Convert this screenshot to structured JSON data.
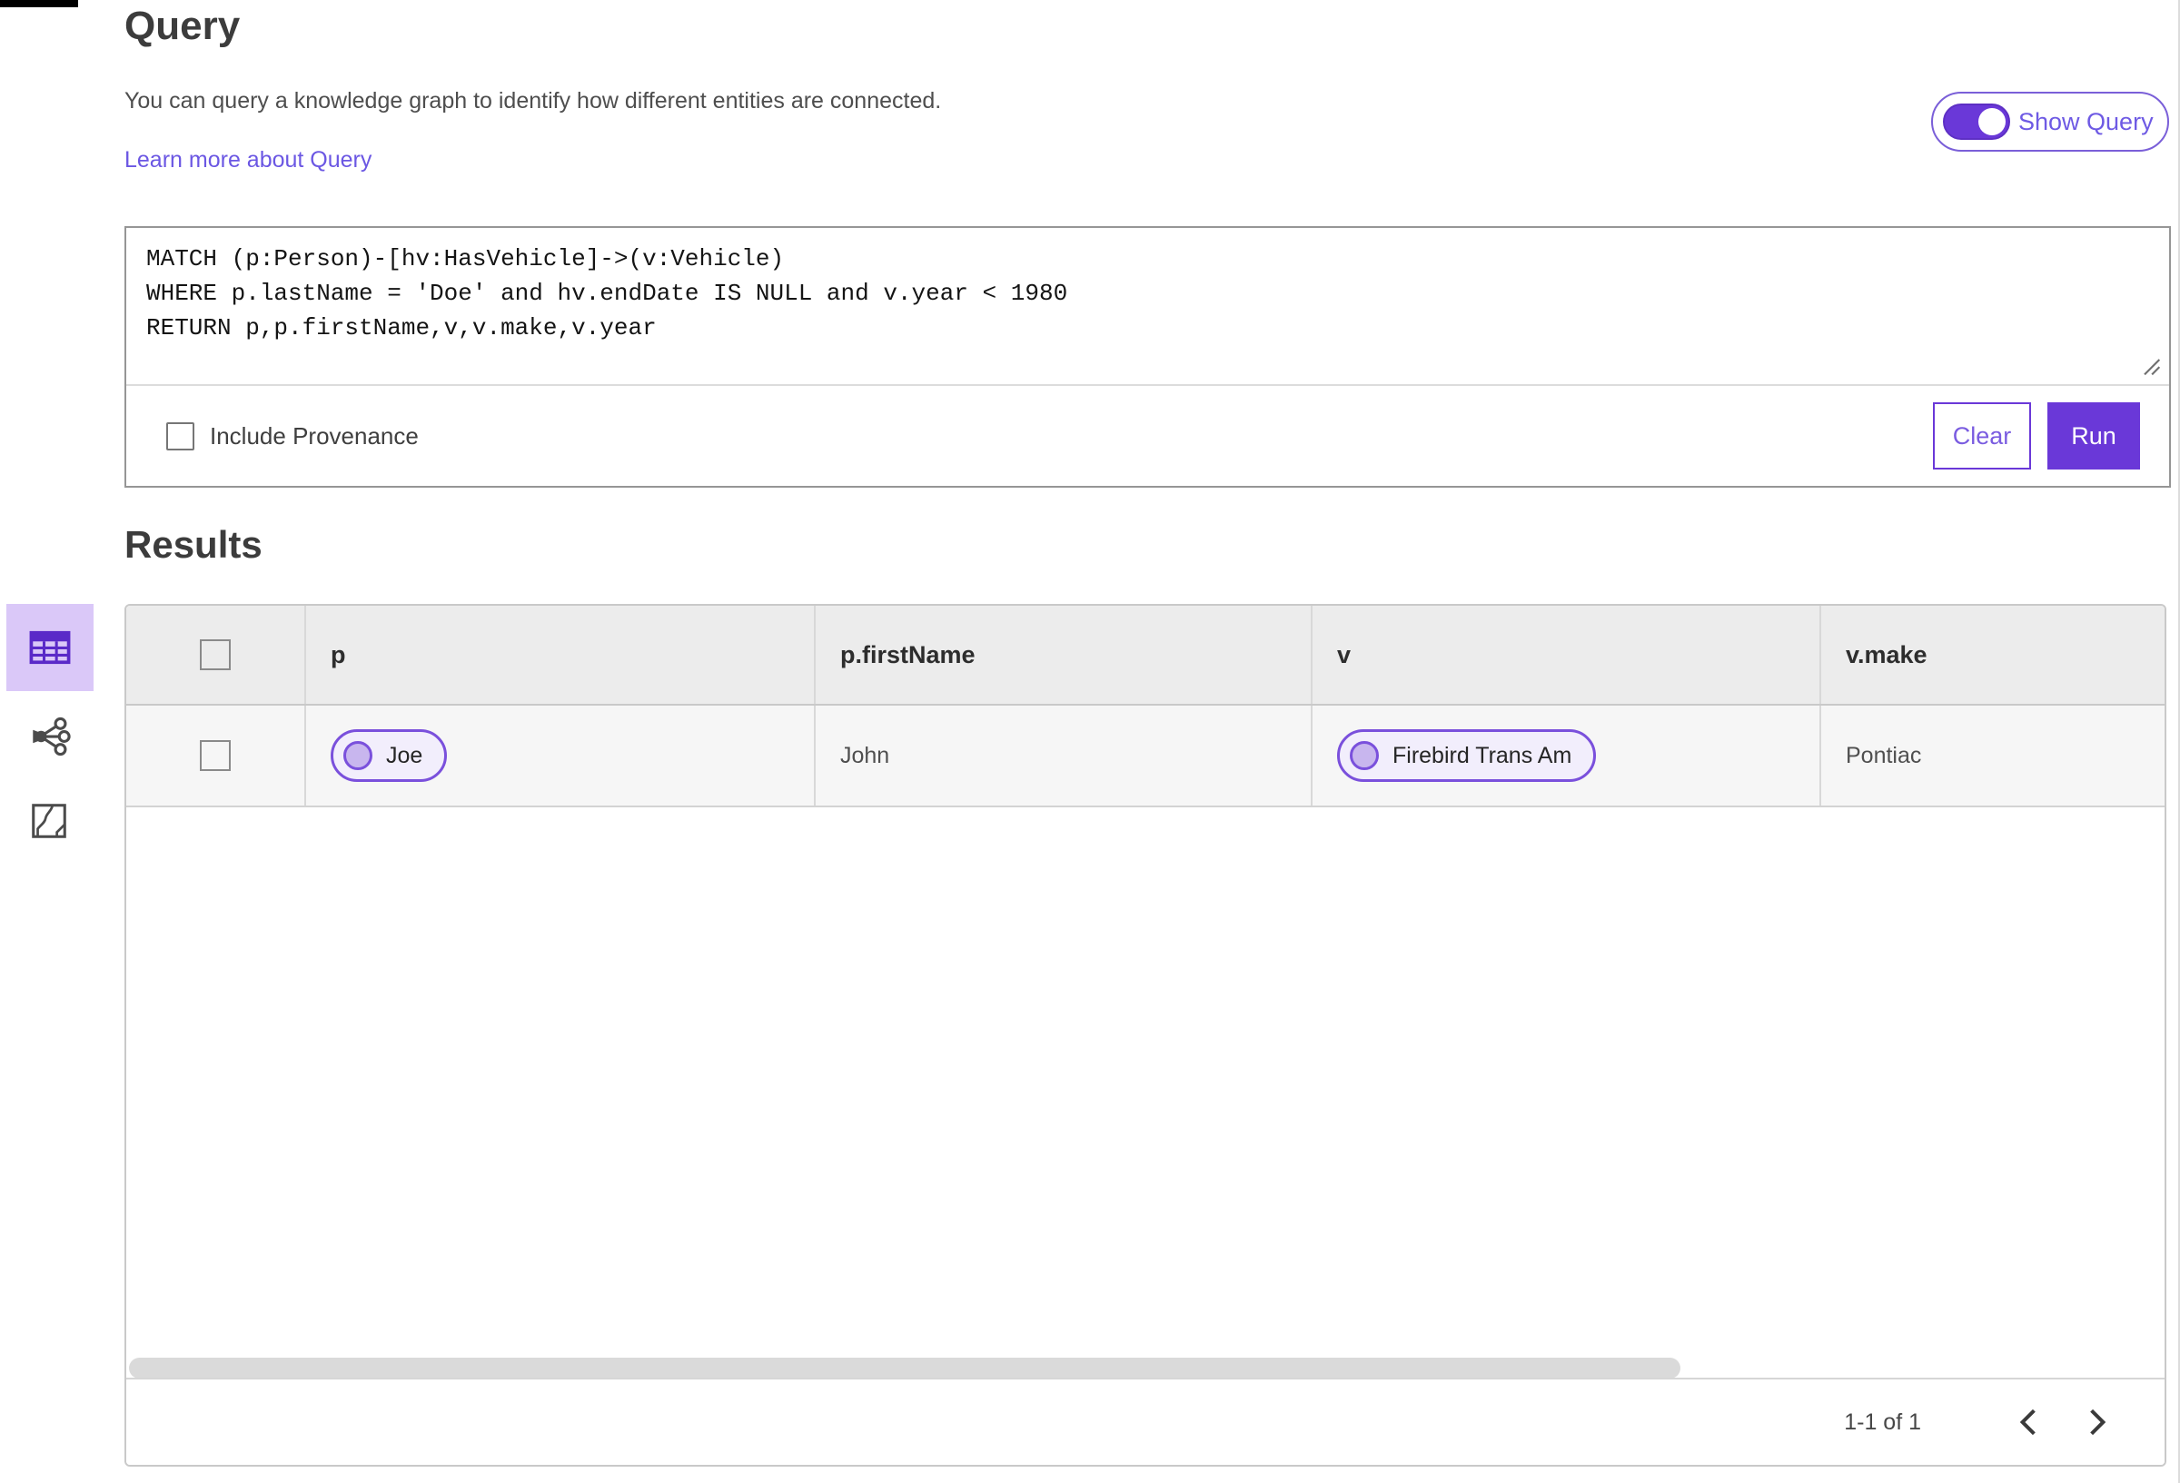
{
  "query_section": {
    "title": "Query",
    "description": "You can query a knowledge graph to identify how different entities are connected.",
    "learn_more_link": "Learn more about Query",
    "show_query_toggle": {
      "label": "Show Query",
      "state_on": true
    },
    "query_text": "MATCH (p:Person)-[hv:HasVehicle]->(v:Vehicle)\nWHERE p.lastName = 'Doe' and hv.endDate IS NULL and v.year < 1980\nRETURN p,p.firstName,v,v.make,v.year",
    "include_provenance": {
      "label": "Include Provenance",
      "checked": false
    },
    "clear_button_label": "Clear",
    "run_button_label": "Run"
  },
  "results_section": {
    "title": "Results",
    "view_rail_icons": [
      "table-view-icon",
      "link-chart-view-icon",
      "map-view-icon"
    ],
    "selected_view": "table-view",
    "table": {
      "columns": [
        "p",
        "p.firstName",
        "v",
        "v.make"
      ],
      "select_all_checked": false,
      "rows": [
        {
          "checked": false,
          "p": "Joe",
          "firstName": "John",
          "v": "Firebird Trans Am",
          "make": "Pontiac"
        }
      ]
    },
    "pagination": {
      "label": "1-1 of 1",
      "prev_icon": "chevron-left-icon",
      "next_icon": "chevron-right-icon"
    }
  },
  "colors": {
    "accent_purple": "#6a38d8",
    "link_purple": "#6b57e3",
    "icon_purple": "#5a2ac8",
    "selected_icon_bg": "#dac8f8",
    "pill_border": "#7a50dc",
    "pill_bg": "#f2eefc",
    "pill_dot_bg": "#c8b6ee",
    "table_header_bg": "#ececec",
    "table_row_bg": "#f6f6f6"
  }
}
